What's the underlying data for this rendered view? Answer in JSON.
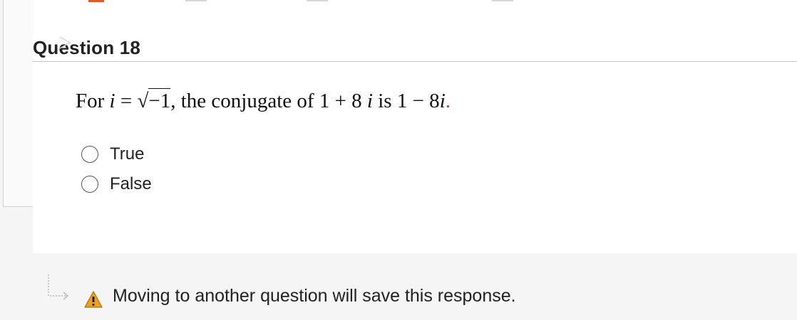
{
  "question": {
    "title": "Question 18",
    "stem": {
      "for": "For",
      "i_var": "i",
      "equals": " = ",
      "radical": "√",
      "radicand": "−1",
      "middle": ", the conjugate of 1 + 8 ",
      "i_var2": "i",
      "is_text": " is 1 − 8",
      "i_var3": "i",
      "period": "."
    },
    "options": [
      {
        "label": "True"
      },
      {
        "label": "False"
      }
    ]
  },
  "footer": {
    "message": "Moving to another question will save this response."
  },
  "colors": {
    "warning": "#f0a020",
    "accent_red": "#d33"
  },
  "icons": {
    "question_marker": "arrow-icon",
    "footer_arrow": "return-arrow-icon",
    "warning": "warning-icon"
  }
}
